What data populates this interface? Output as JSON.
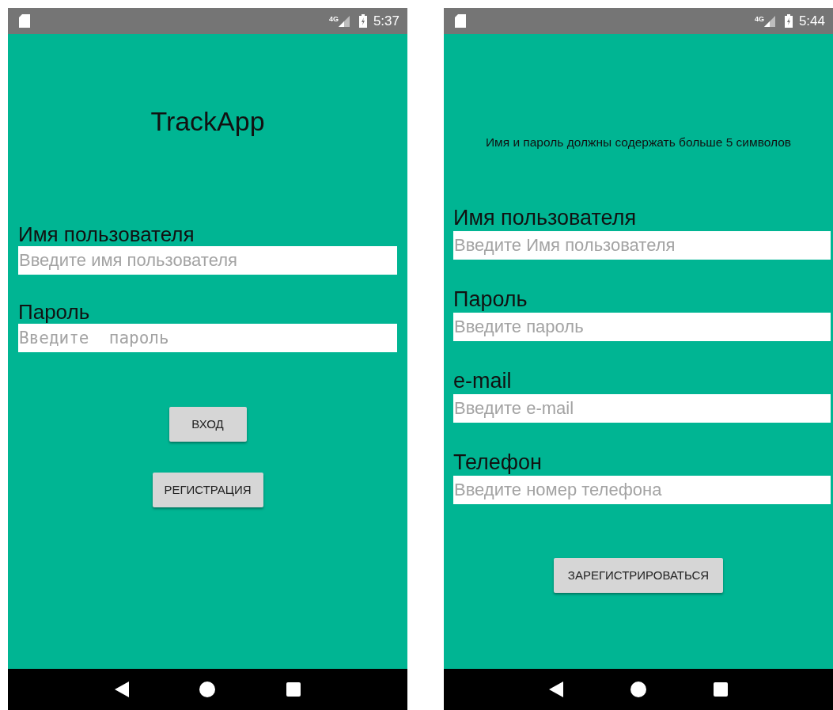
{
  "screens": [
    {
      "status_bar": {
        "network": "4G",
        "time": "5:37"
      },
      "title": "TrackApp",
      "fields": [
        {
          "label": "Имя пользователя",
          "placeholder": "Введите имя пользователя",
          "kind": "text"
        },
        {
          "label": "Пароль",
          "placeholder": "Введите  пароль",
          "kind": "password"
        }
      ],
      "buttons": [
        "ВХОД",
        "РЕГИСТРАЦИЯ"
      ]
    },
    {
      "status_bar": {
        "network": "4G",
        "time": "5:44"
      },
      "message": "Имя и пароль должны содержать больше 5 символов",
      "fields": [
        {
          "label": "Имя пользователя",
          "placeholder": "Введите Имя пользователя",
          "kind": "text"
        },
        {
          "label": "Пароль",
          "placeholder": "Введите пароль",
          "kind": "text"
        },
        {
          "label": "e-mail",
          "placeholder": "Введите e-mail",
          "kind": "text"
        },
        {
          "label": "Телефон",
          "placeholder": "Введите номер телефона",
          "kind": "text"
        }
      ],
      "buttons": [
        "ЗАРЕГИСТРИРОВАТЬСЯ"
      ]
    }
  ]
}
